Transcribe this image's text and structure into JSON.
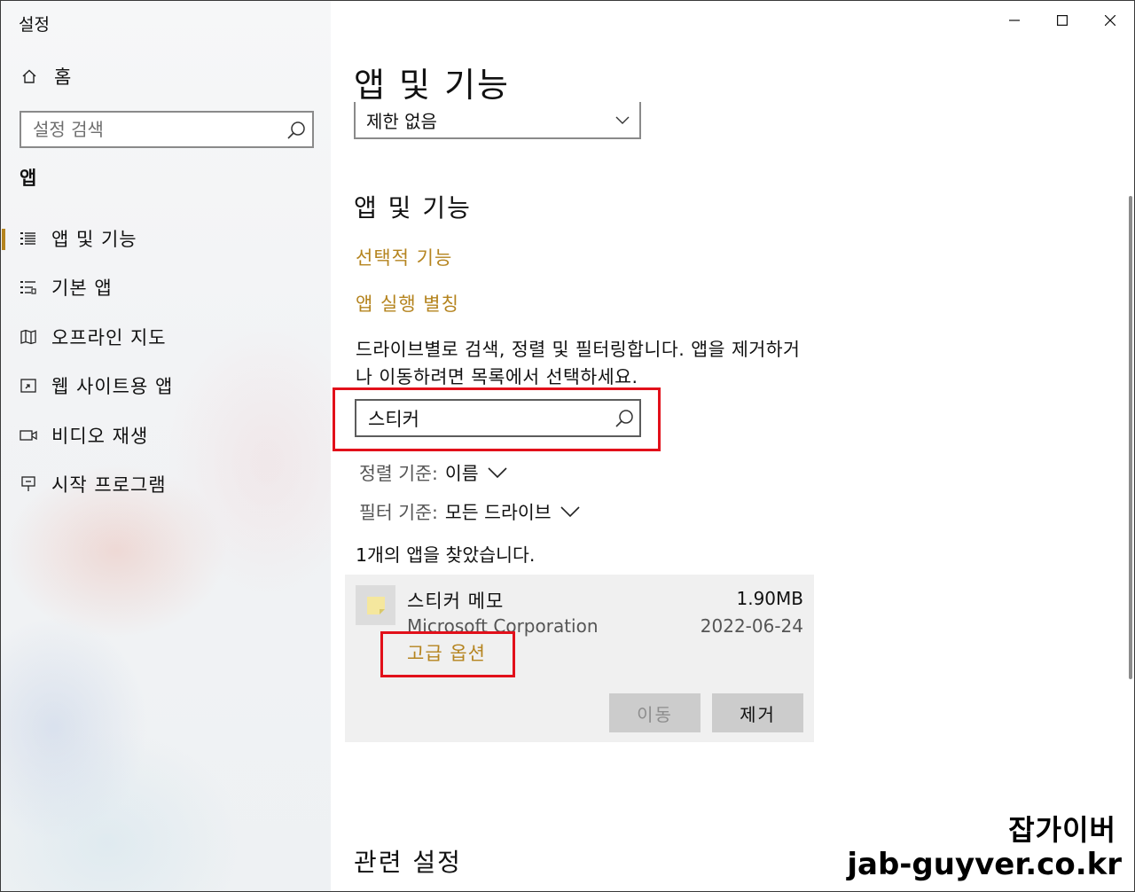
{
  "window": {
    "title": "설정"
  },
  "sidebar": {
    "home_label": "홈",
    "search_placeholder": "설정 검색",
    "section_title": "앱",
    "items": [
      {
        "label": "앱 및 기능",
        "icon": "apps-list-icon",
        "active": true
      },
      {
        "label": "기본 앱",
        "icon": "default-apps-icon",
        "active": false
      },
      {
        "label": "오프라인 지도",
        "icon": "map-icon",
        "active": false
      },
      {
        "label": "웹 사이트용 앱",
        "icon": "website-app-icon",
        "active": false
      },
      {
        "label": "비디오 재생",
        "icon": "video-icon",
        "active": false
      },
      {
        "label": "시작 프로그램",
        "icon": "startup-icon",
        "active": false
      }
    ]
  },
  "main": {
    "page_title": "앱 및 기능",
    "top_dropdown_value": "제한 없음",
    "sub_title": "앱 및 기능",
    "links": {
      "optional_features": "선택적 기능",
      "app_execution_alias": "앱 실행 별칭"
    },
    "description": "드라이브별로 검색, 정렬 및 필터링합니다. 앱을 제거하거나 이동하려면 목록에서 선택하세요.",
    "app_search_value": "스티커",
    "sort": {
      "key": "정렬 기준:",
      "value": "이름"
    },
    "filter": {
      "key": "필터 기준:",
      "value": "모든 드라이브"
    },
    "found_text": "1개의 앱을 찾았습니다.",
    "app": {
      "name": "스티커 메모",
      "publisher": "Microsoft Corporation",
      "size": "1.90MB",
      "date": "2022-06-24",
      "advanced_options": "고급 옵션",
      "move_label": "이동",
      "remove_label": "제거"
    },
    "related_title": "관련 설정"
  },
  "watermark": {
    "line1": "잡가이버",
    "line2": "jab-guyver.co.kr"
  },
  "colors": {
    "accent": "#b5841f",
    "highlight_box": "#e2101a",
    "card_bg": "#f0f0f0",
    "button_bg": "#cccccc"
  }
}
